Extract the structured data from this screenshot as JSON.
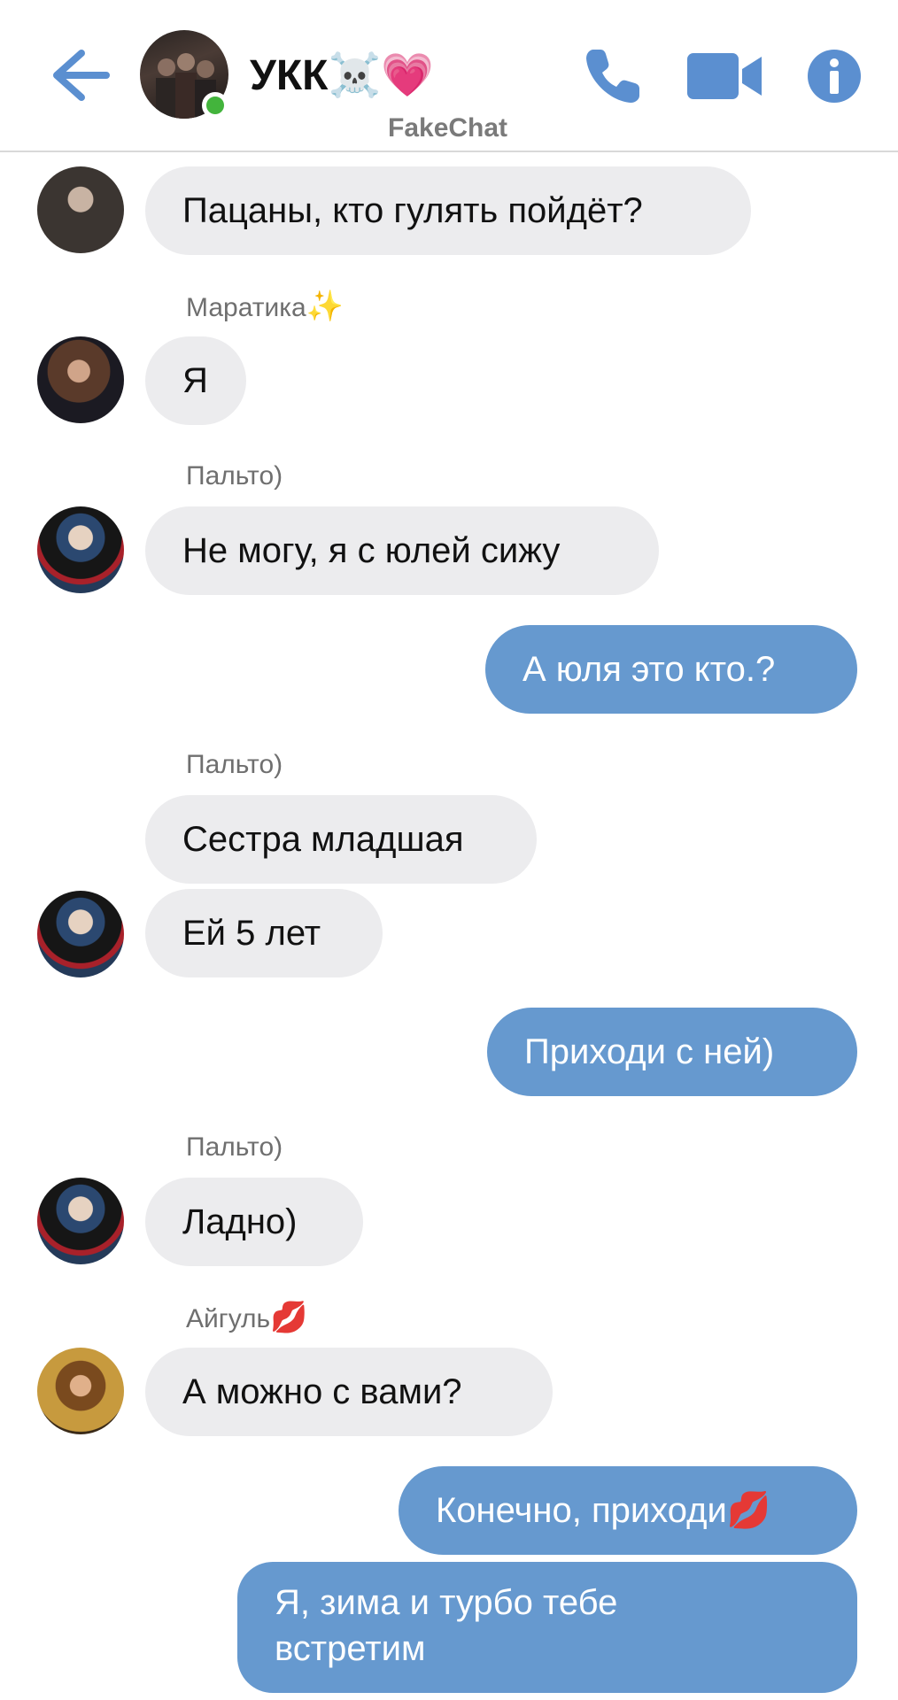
{
  "header": {
    "title": "УКК",
    "title_emoji": "☠️💗",
    "subtitle": "FakeChat",
    "status": "online"
  },
  "colors": {
    "accent": "#5b8fd0",
    "incoming_bubble": "#ececee",
    "outgoing_bubble": "#6699cf",
    "online": "#43b43c"
  },
  "messages": [
    {
      "direction": "in",
      "text": "Пацаны, кто гулять пойдёт?"
    },
    {
      "direction": "in",
      "sender": "Маратика",
      "sender_emoji": "✨",
      "text": "Я"
    },
    {
      "direction": "in",
      "sender": "Пальто)",
      "text": "Не могу, я с юлей сижу"
    },
    {
      "direction": "out",
      "text": "А юля это кто.?"
    },
    {
      "direction": "in",
      "sender": "Пальто)",
      "text": "Сестра младшая"
    },
    {
      "direction": "in",
      "text": "Ей 5 лет"
    },
    {
      "direction": "out",
      "text": "Приходи с ней)"
    },
    {
      "direction": "in",
      "sender": "Пальто)",
      "text": "Ладно)"
    },
    {
      "direction": "in",
      "sender": "Айгуль",
      "sender_emoji": "💋",
      "text": "А можно с вами?"
    },
    {
      "direction": "out",
      "text": "Конечно, приходи",
      "emoji": "💋"
    },
    {
      "direction": "out",
      "text_line1": "Я, зима и турбо тебе",
      "text_line2": "встретим"
    }
  ]
}
